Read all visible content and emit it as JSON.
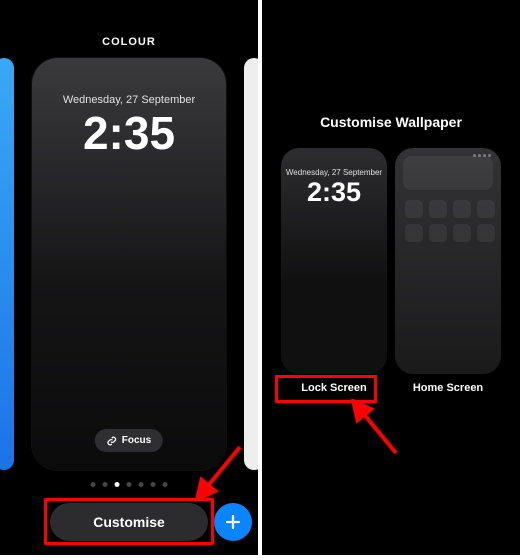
{
  "left": {
    "title": "COLOUR",
    "card": {
      "date": "Wednesday, 27 September",
      "time": "2:35",
      "focus_label": "Focus"
    },
    "page_dots": {
      "count": 7,
      "active_index": 2
    },
    "customise_label": "Customise",
    "add_icon": "plus-icon"
  },
  "right": {
    "title": "Customise Wallpaper",
    "lock_thumb": {
      "date": "Wednesday, 27 September",
      "time": "2:35",
      "label": "Lock Screen"
    },
    "home_thumb": {
      "label": "Home Screen"
    }
  },
  "annotations": {
    "highlight_color": "#ff0000",
    "left_arrow_points_to": "customise-button",
    "right_arrow_points_to": "lock-screen-label"
  }
}
